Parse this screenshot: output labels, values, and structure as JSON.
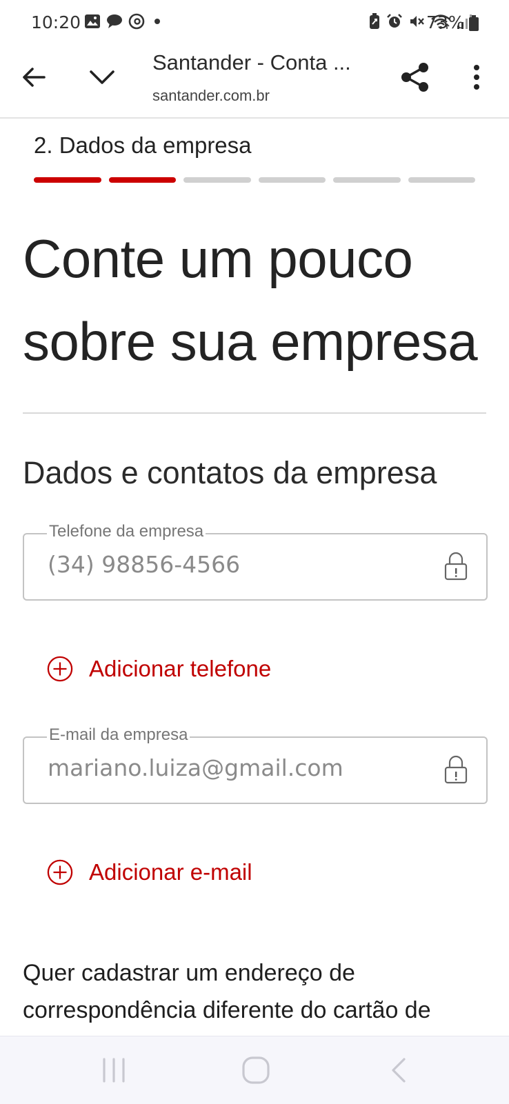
{
  "status_bar": {
    "time": "10:20",
    "left_icons": [
      "gallery-icon",
      "chat-bubble-icon",
      "threads-icon",
      "dot-icon"
    ],
    "right_icons": [
      "battery-saver-icon",
      "alarm-icon",
      "mute-icon",
      "wifi-icon",
      "signal-icon"
    ],
    "battery": "73%"
  },
  "toolbar": {
    "title": "Santander - Conta ...",
    "url": "santander.com.br"
  },
  "stepper": {
    "label": "2.  Dados da empresa",
    "total_steps": 6,
    "completed_steps": 2,
    "active_color": "#cc0000",
    "inactive_color": "#d0d0d0"
  },
  "page": {
    "heading": "Conte um pouco sobre sua empresa",
    "section_title": "Dados e contatos da empresa",
    "phone_field": {
      "label": "Telefone da empresa",
      "value": "(34) 98856-4566"
    },
    "add_phone": "Adicionar telefone",
    "email_field": {
      "label": "E-mail da empresa",
      "value": "mariano.luiza@gmail.com"
    },
    "add_email": "Adicionar e-mail",
    "question": "Quer cadastrar um endereço de correspondência diferente do cartão de CNPJ?"
  },
  "colors": {
    "accent": "#c00000"
  }
}
